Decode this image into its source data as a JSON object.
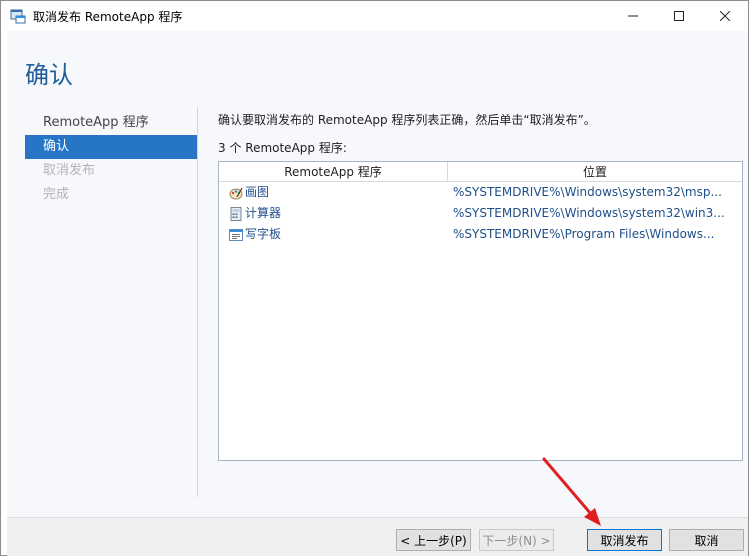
{
  "window": {
    "title": "取消发布 RemoteApp 程序",
    "controls": {
      "minimize": "—",
      "maximize": "☐",
      "close": "✕"
    }
  },
  "header": {
    "title": "确认"
  },
  "nav": {
    "items": [
      {
        "label": "RemoteApp 程序",
        "state": "normal"
      },
      {
        "label": "确认",
        "state": "active"
      },
      {
        "label": "取消发布",
        "state": "disabled"
      },
      {
        "label": "完成",
        "state": "disabled"
      }
    ]
  },
  "main": {
    "description": "确认要取消发布的 RemoteApp 程序列表正确，然后单击“取消发布”。",
    "count_label": "3 个 RemoteApp 程序:",
    "table": {
      "columns": [
        "RemoteApp 程序",
        "位置"
      ],
      "rows": [
        {
          "name": "画图",
          "icon": "paint-icon",
          "location": "%SYSTEMDRIVE%\\Windows\\system32\\msp..."
        },
        {
          "name": "计算器",
          "icon": "calculator-icon",
          "location": "%SYSTEMDRIVE%\\Windows\\system32\\win3..."
        },
        {
          "name": "写字板",
          "icon": "wordpad-icon",
          "location": "%SYSTEMDRIVE%\\Program Files\\Windows..."
        }
      ]
    }
  },
  "footer": {
    "prev_label": "< 上一步(P)",
    "next_label": "下一步(N) >",
    "unpublish_label": "取消发布",
    "cancel_label": "取消"
  },
  "colors": {
    "accent": "#2675c6",
    "header_text": "#1f5d99",
    "annotation_arrow": "#e02020"
  }
}
